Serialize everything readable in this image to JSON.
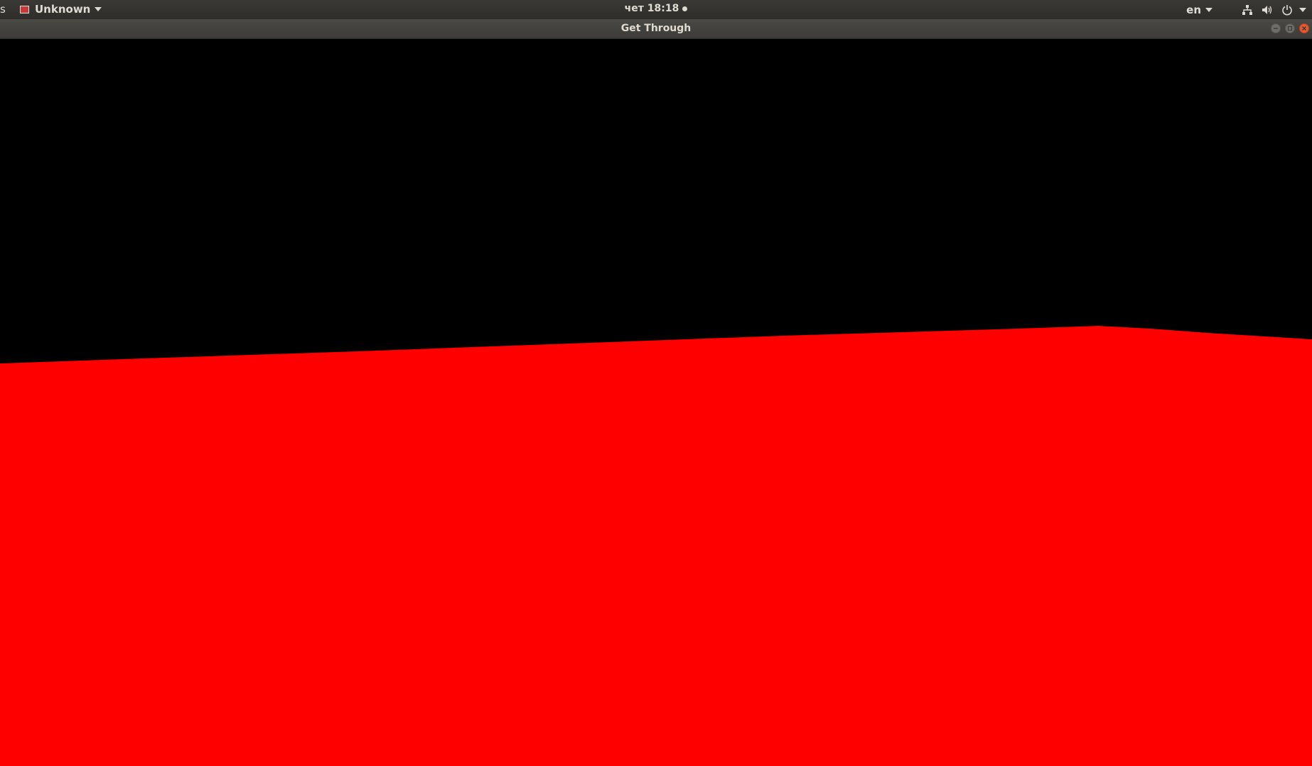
{
  "top_panel": {
    "activities_label": "s",
    "app_menu_label": "Unknown",
    "clock": "чет 18:18",
    "language": "en"
  },
  "window": {
    "title": "Get Through"
  },
  "game": {
    "sky_color": "#000000",
    "ground_color": "#ff0000"
  },
  "icons": {
    "app": "app-window-icon",
    "network": "network-icon",
    "volume": "volume-icon",
    "power": "power-icon",
    "minimize": "minimize-icon",
    "maximize": "maximize-icon",
    "close": "close-icon"
  }
}
